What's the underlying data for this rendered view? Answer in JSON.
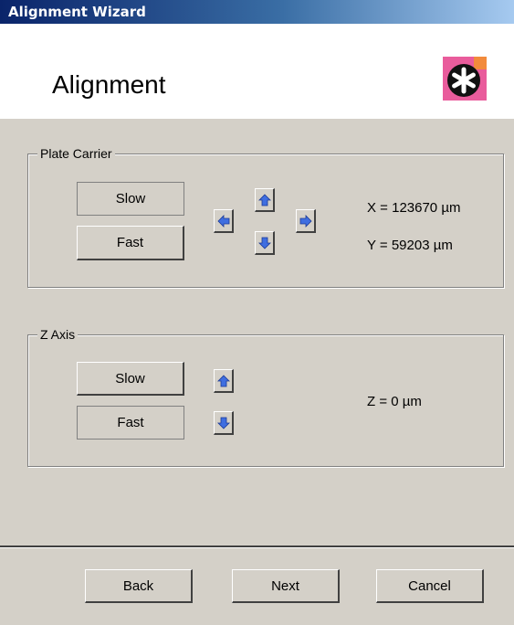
{
  "window": {
    "title": "Alignment Wizard"
  },
  "header": {
    "title": "Alignment",
    "logo_icon": "asterisk-badge-icon",
    "logo_color": "#e95c9c"
  },
  "plate_carrier": {
    "label": "Plate Carrier",
    "slow_label": "Slow",
    "fast_label": "Fast",
    "x_readout": "X = 123670 µm",
    "y_readout": "Y = 59203 µm"
  },
  "z_axis": {
    "label": "Z Axis",
    "slow_label": "Slow",
    "fast_label": "Fast",
    "z_readout": "Z = 0 µm"
  },
  "footer": {
    "back_label": "Back",
    "next_label": "Next",
    "cancel_label": "Cancel"
  },
  "colors": {
    "titlebar_start": "#0a246a",
    "titlebar_end": "#a6caf0",
    "arrow_blue": "#3f6ee0",
    "face": "#d4d0c8"
  }
}
